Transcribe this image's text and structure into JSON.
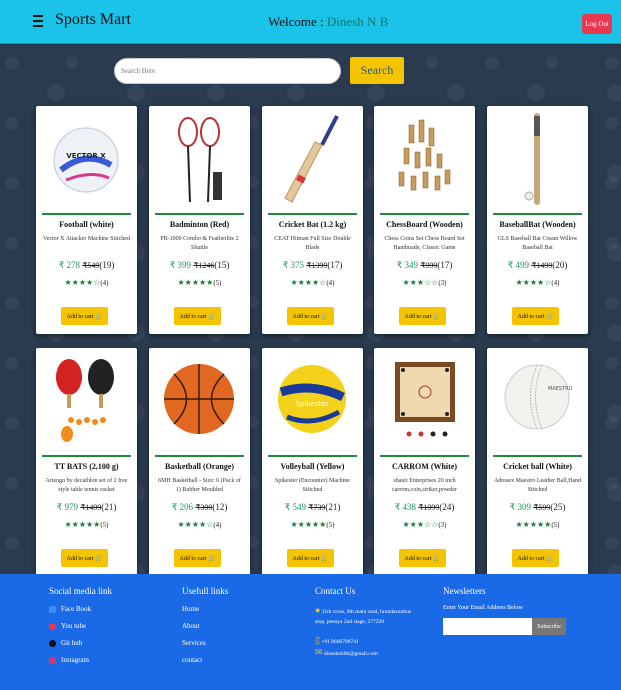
{
  "header": {
    "brand": "Sports Mart",
    "welcome_prefix": "Welcome : ",
    "username": "Dinesh N B",
    "logout_label": "Log Out"
  },
  "search": {
    "placeholder": "Search Here",
    "button_label": "Search"
  },
  "products": [
    {
      "name": "Football (white)",
      "desc": "Vector X Attacker Machine Stitched",
      "price": "278",
      "mrp": "549",
      "sold": "(19)",
      "stars": 4,
      "stars_text": "★★★★☆",
      "rating_count": "(4)",
      "cart_label": "Add to cart"
    },
    {
      "name": "Badminton (Red)",
      "desc": "PB-1000 Combo & Featherlite 2 Shuttle",
      "price": "399",
      "mrp": "1246",
      "sold": "(15)",
      "stars": 5,
      "stars_text": "★★★★★",
      "rating_count": "(5)",
      "cart_label": "Add to cart"
    },
    {
      "name": "Cricket Bat (1.2 kg)",
      "desc": "CEAT Hitman Full Size Double Blade",
      "price": "375",
      "mrp": "1399",
      "sold": "(17)",
      "stars": 4,
      "stars_text": "★★★★☆",
      "rating_count": "(4)",
      "cart_label": "Add to cart"
    },
    {
      "name": "ChessBoard (Wooden)",
      "desc": "Chess Coins Set Chess Board Set Handmade, Classic Game",
      "price": "349",
      "mrp": "999",
      "sold": "(17)",
      "stars": 3,
      "stars_text": "★★★☆☆",
      "rating_count": "(3)",
      "cart_label": "Add to cart"
    },
    {
      "name": "BaseballBat (Wooden)",
      "desc": "GLS Baseball Bat Cream Willow Baseball Bat",
      "price": "499",
      "mrp": "1499",
      "sold": "(20)",
      "stars": 4,
      "stars_text": "★★★★☆",
      "rating_count": "(4)",
      "cart_label": "Add to cart"
    },
    {
      "name": "TT BATS (2,100 g)",
      "desc": "Artengo by decathlon set of 2 free style table tennis racket",
      "price": "979",
      "mrp": "1499",
      "sold": "(21)",
      "stars": 5,
      "stars_text": "★★★★★",
      "rating_count": "(5)",
      "cart_label": "Add to cart"
    },
    {
      "name": "Basketball (Orange)",
      "desc": "6MH Basketball - Size: 6 (Pack of 1) Rubber Moulded",
      "price": "206",
      "mrp": "399",
      "sold": "(12)",
      "stars": 4,
      "stars_text": "★★★★☆",
      "rating_count": "(4)",
      "cart_label": "Add to cart"
    },
    {
      "name": "Volleyball (Yellow)",
      "desc": "Spikester (Encounter) Machine Stitched",
      "price": "549",
      "mrp": "739",
      "sold": "(21)",
      "stars": 5,
      "stars_text": "★★★★★",
      "rating_count": "(5)",
      "cart_label": "Add to cart"
    },
    {
      "name": "CARROM (White)",
      "desc": "shauti Enterprises 20 inch carrom,coin,striker,powder",
      "price": "438",
      "mrp": "1999",
      "sold": "(24)",
      "stars": 3,
      "stars_text": "★★★☆☆",
      "rating_count": "(3)",
      "cart_label": "Add to cart"
    },
    {
      "name": "Cricket ball (White)",
      "desc": "Adreaex Maestro Leather Ball,Hand Stitched",
      "price": "309",
      "mrp": "599",
      "sold": "(25)",
      "stars": 5,
      "stars_text": "★★★★★",
      "rating_count": "(5)",
      "cart_label": "Add to cart"
    }
  ],
  "currency_symbol": "₹",
  "footer": {
    "social": {
      "heading": "Social media link",
      "links": [
        "Face Book",
        "You tube",
        "Git hub",
        "Instagram"
      ]
    },
    "useful": {
      "heading": "Usefull links",
      "links": [
        "Home",
        "About",
        "Services",
        "contact"
      ]
    },
    "contact": {
      "heading": "Contact Us",
      "address": "11th cross, 8th main road, brundavanbus stop, peenya 2nd stage, 577228",
      "phone": "+91 8660706741",
      "email": "dineshnb66@gmail.com"
    },
    "newsletter": {
      "heading": "Newsletters",
      "label": "Enter Your Email Address Below",
      "button_label": "Subscribe"
    }
  },
  "colors": {
    "topbar": "#1bc3e8",
    "accent_yellow": "#f5c400",
    "footer": "#1a6ae8",
    "logout": "#e8384f",
    "star_green": "#1a7a3a"
  }
}
